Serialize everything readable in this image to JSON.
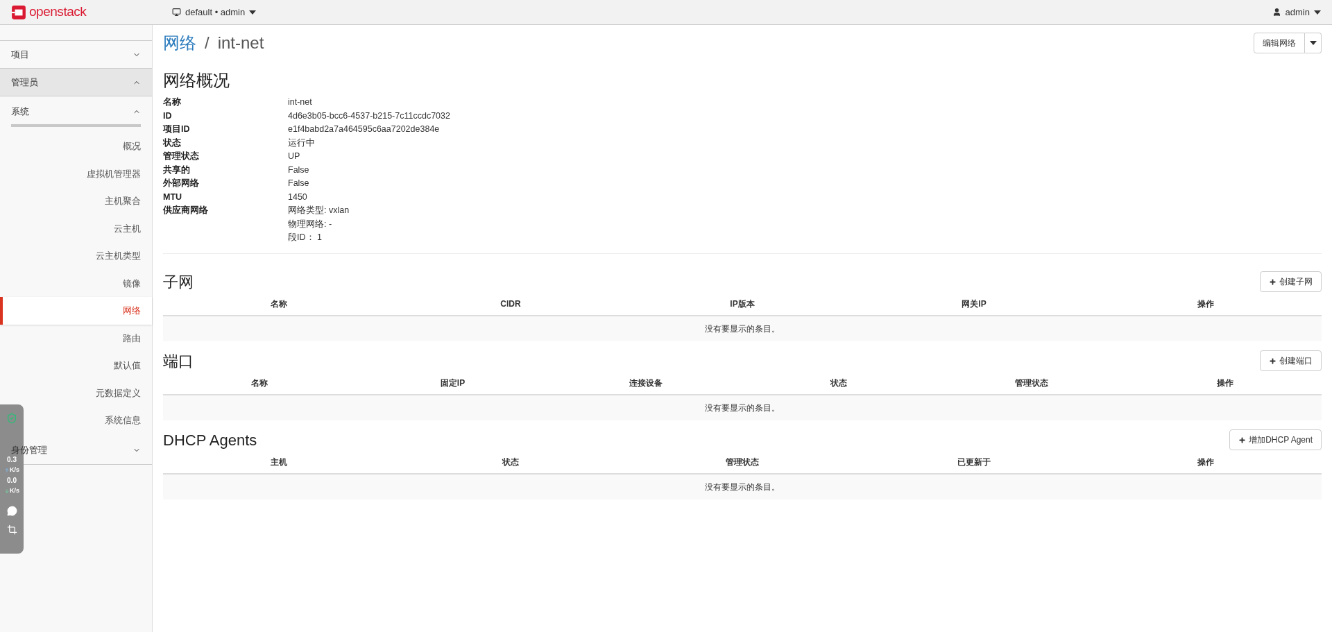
{
  "header": {
    "logo": "openstack",
    "project_menu": "default • admin",
    "user_menu": "admin"
  },
  "sidebar": {
    "panels": [
      {
        "label": "项目",
        "expanded": false,
        "highlighted": false
      },
      {
        "label": "管理员",
        "expanded": true,
        "highlighted": true,
        "children": [
          {
            "label": "系统",
            "expanded": true,
            "children": [
              {
                "label": "概况",
                "selected": false
              },
              {
                "label": "虚拟机管理器",
                "selected": false
              },
              {
                "label": "主机聚合",
                "selected": false
              },
              {
                "label": "云主机",
                "selected": false
              },
              {
                "label": "云主机类型",
                "selected": false
              },
              {
                "label": "镜像",
                "selected": false
              },
              {
                "label": "网络",
                "selected": true
              },
              {
                "label": "路由",
                "selected": false
              },
              {
                "label": "默认值",
                "selected": false
              },
              {
                "label": "元数据定义",
                "selected": false
              },
              {
                "label": "系统信息",
                "selected": false
              }
            ]
          }
        ]
      },
      {
        "label": "身份管理",
        "expanded": false,
        "highlighted": false
      }
    ]
  },
  "breadcrumb": {
    "parent": "网络",
    "separator": "/",
    "current": "int-net"
  },
  "edit_button": "编辑网络",
  "overview": {
    "title": "网络概况",
    "rows": [
      {
        "label": "名称",
        "values": [
          "int-net"
        ]
      },
      {
        "label": "ID",
        "values": [
          "4d6e3b05-bcc6-4537-b215-7c11ccdc7032"
        ]
      },
      {
        "label": "项目ID",
        "values": [
          "e1f4babd2a7a464595c6aa7202de384e"
        ]
      },
      {
        "label": "状态",
        "values": [
          "运行中"
        ]
      },
      {
        "label": "管理状态",
        "values": [
          "UP"
        ]
      },
      {
        "label": "共享的",
        "values": [
          "False"
        ]
      },
      {
        "label": "外部网络",
        "values": [
          "False"
        ]
      },
      {
        "label": "MTU",
        "values": [
          "1450"
        ]
      },
      {
        "label": "供应商网络",
        "values": [
          "网络类型: vxlan",
          "物理网络: -",
          "段ID： 1"
        ]
      }
    ]
  },
  "tables": [
    {
      "title": "子网",
      "button": "创建子网",
      "columns": [
        "名称",
        "CIDR",
        "IP版本",
        "网关IP",
        "操作"
      ],
      "empty_message": "没有要显示的条目。"
    },
    {
      "title": "端口",
      "button": "创建端口",
      "columns": [
        "名称",
        "固定IP",
        "连接设备",
        "状态",
        "管理状态",
        "操作"
      ],
      "empty_message": "没有要显示的条目。"
    },
    {
      "title": "DHCP Agents",
      "button": "增加DHCP Agent",
      "columns": [
        "主机",
        "状态",
        "管理状态",
        "已更新于",
        "操作"
      ],
      "empty_message": "没有要显示的条目。"
    }
  ],
  "speed_widget": {
    "upload_value": "0.3",
    "upload_unit": "K/s",
    "download_value": "0.0",
    "download_unit": "K/s"
  }
}
